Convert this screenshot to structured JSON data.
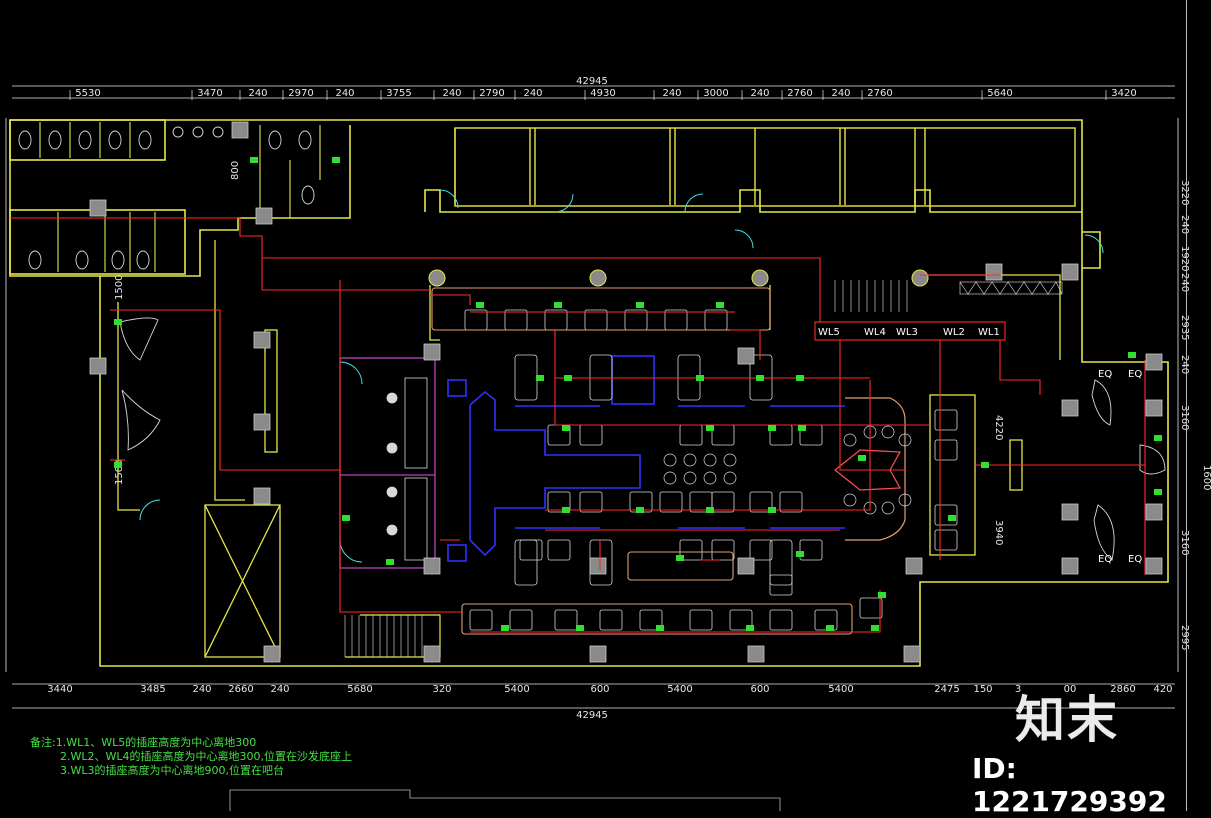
{
  "overall_dimension": "42945",
  "top_dims": [
    "5530",
    "3470",
    "240",
    "2970",
    "240",
    "3755",
    "240",
    "2790",
    "240",
    "4930",
    "240",
    "3000",
    "240",
    "2760",
    "240",
    "2760",
    "5640",
    "3420"
  ],
  "bottom_dims": [
    "3440",
    "3485",
    "240",
    "2660",
    "240",
    "5680",
    "320",
    "5400",
    "600",
    "5400",
    "600",
    "5400",
    "2475",
    "150",
    "3",
    "00",
    "2860",
    "420"
  ],
  "right_dims": [
    "3220",
    "240",
    "1920",
    "240",
    "2935",
    "240",
    "4220",
    "3160",
    "3940",
    "1600",
    "3160",
    "2995"
  ],
  "left_dims": [
    "800",
    "1500",
    "1500"
  ],
  "circuit_labels": [
    "WL5",
    "WL4",
    "WL3",
    "WL2",
    "WL1"
  ],
  "eq_labels": [
    "EQ",
    "EQ",
    "EQ",
    "EQ"
  ],
  "notes": [
    "备注:1.WL1、WL5的插座高度为中心离地300",
    "2.WL2、WL4的插座高度为中心离地300,位置在沙发底座上",
    "3.WL3的插座高度为中心离地900,位置在吧台"
  ],
  "logo_text": "知末",
  "id_text": "ID: 1221729392",
  "colors": {
    "background": "#000000",
    "wall": "#e6e64a",
    "circuit": "#ff2a2a",
    "furniture": "#d8d8d8",
    "bar": "#3030ff",
    "partition": "#c040c0",
    "door": "#40e0e0",
    "outlet": "#30e030",
    "note": "#46e046"
  }
}
